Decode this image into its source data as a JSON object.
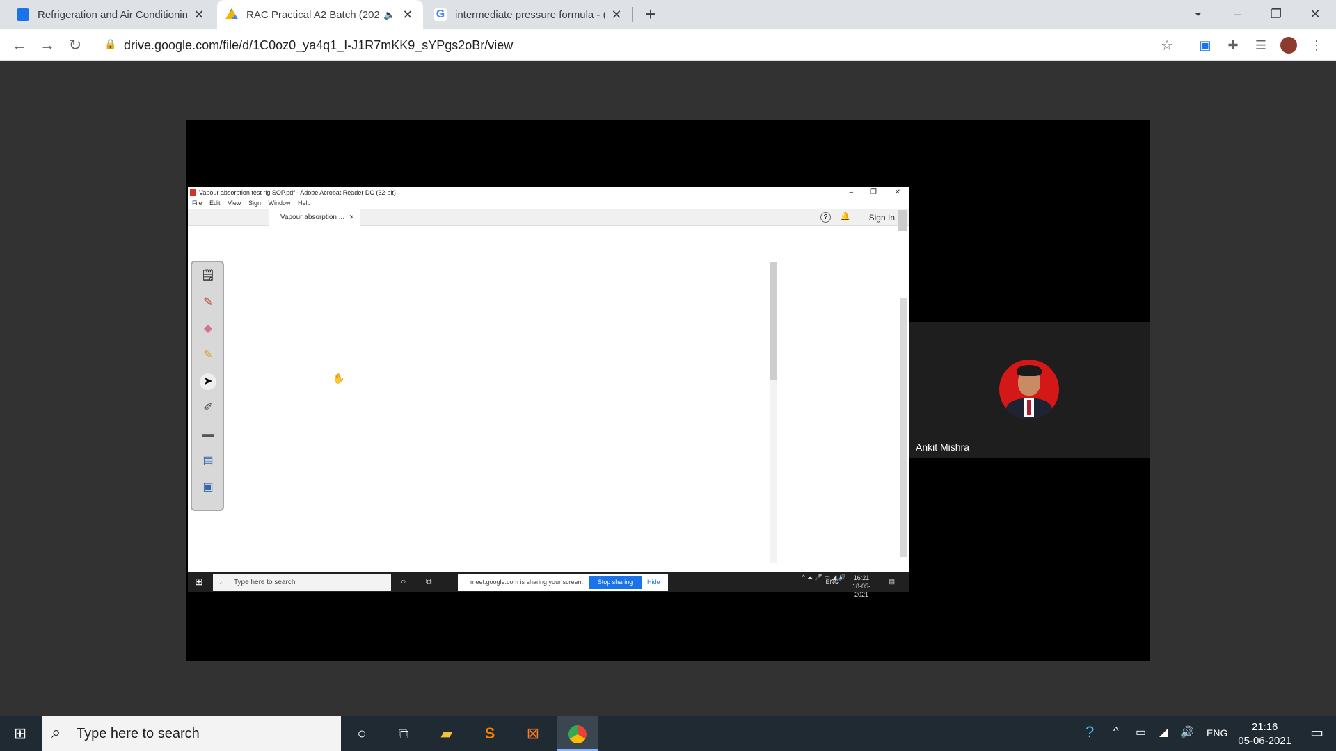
{
  "browser": {
    "tabs": [
      {
        "title": "Refrigeration and Air Conditionin",
        "favicon_color": "#1a73e8"
      },
      {
        "title": "RAC Practical A2 Batch (202",
        "favicon_color": "#0f9d58",
        "active": true
      },
      {
        "title": "intermediate pressure formula - (",
        "favicon_color": "#ffffff"
      }
    ],
    "new_tab_label": "+",
    "url": "drive.google.com/file/d/1C0oz0_ya4q1_I-J1R7mKK9_sYPgs2oBr/view"
  },
  "meet": {
    "participant_name": "Ankit Mishra"
  },
  "acrobat": {
    "title": "Vapour absorption test rig SOP.pdf - Adobe Acrobat Reader DC (32-bit)",
    "menu": [
      "File",
      "Edit",
      "View",
      "Sign",
      "Window",
      "Help"
    ],
    "doc_tab": "Vapour absorption ...",
    "sign_in": "Sign In",
    "inner_taskbar": {
      "search_placeholder": "Type here to search",
      "share_text": "meet.google.com is sharing your screen.",
      "stop_sharing": "Stop sharing",
      "hide": "Hide",
      "lang": "ENG",
      "time": "16:21",
      "date": "18-05-2021"
    }
  },
  "taskbar": {
    "search_placeholder": "Type here to search",
    "lang": "ENG",
    "time": "21:16",
    "date": "05-06-2021"
  }
}
